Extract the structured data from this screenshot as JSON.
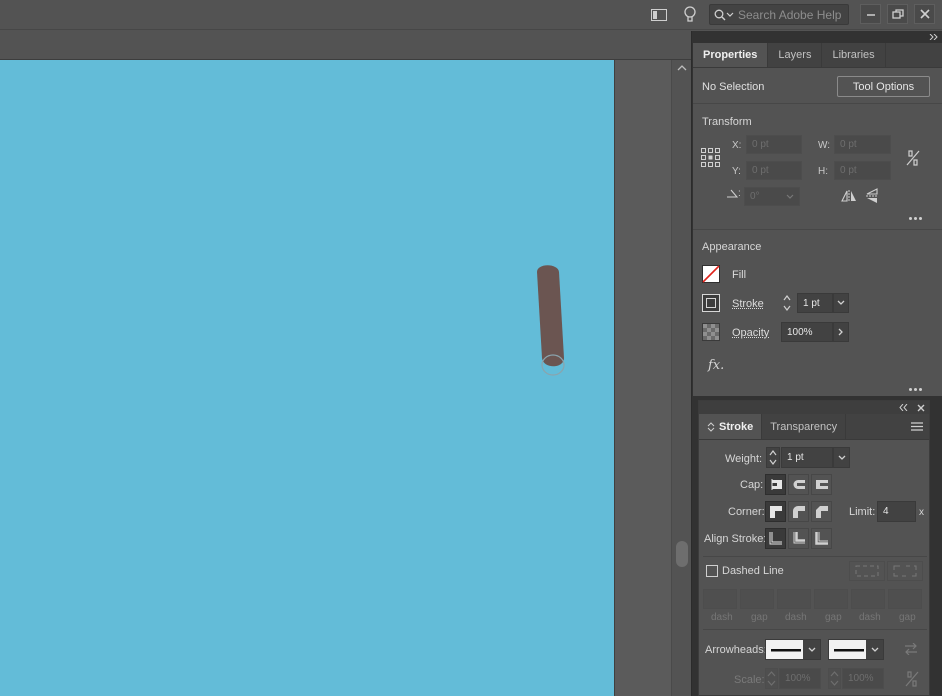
{
  "titlebar": {
    "search_placeholder": "Search Adobe Help",
    "icons": [
      "workspace-switcher-icon",
      "lightbulb-icon",
      "search-icon",
      "minimize-icon",
      "restore-icon",
      "close-icon"
    ]
  },
  "properties_panel": {
    "tabs": [
      "Properties",
      "Layers",
      "Libraries"
    ],
    "active_tab": "Properties",
    "selection_label": "No Selection",
    "tool_options_label": "Tool Options",
    "transform": {
      "title": "Transform",
      "x_label": "X:",
      "x_value": "0 pt",
      "y_label": "Y:",
      "y_value": "0 pt",
      "w_label": "W:",
      "w_value": "0 pt",
      "h_label": "H:",
      "h_value": "0 pt",
      "rotate_label": ":",
      "rotate_value": "0°"
    },
    "appearance": {
      "title": "Appearance",
      "fill_label": "Fill",
      "stroke_label": "Stroke",
      "stroke_value": "1 pt",
      "opacity_label": "Opacity",
      "opacity_value": "100%",
      "fx_label": "fx."
    }
  },
  "stroke_panel": {
    "tabs": [
      "Stroke",
      "Transparency"
    ],
    "active_tab": "Stroke",
    "weight_label": "Weight:",
    "weight_value": "1 pt",
    "cap_label": "Cap:",
    "corner_label": "Corner:",
    "limit_label": "Limit:",
    "limit_value": "4",
    "limit_unit": "x",
    "align_label": "Align Stroke:",
    "dashed_label": "Dashed Line",
    "dashed_checked": false,
    "dash_labels": [
      "dash",
      "gap",
      "dash",
      "gap",
      "dash",
      "gap"
    ],
    "arrowheads_label": "Arrowheads:",
    "scale_label": "Scale:",
    "scale_values": [
      "100%",
      "100%"
    ]
  },
  "colors": {
    "artboard": "#63bcd8",
    "shape_fill": "#6b5551",
    "ui_bg": "#535353"
  }
}
